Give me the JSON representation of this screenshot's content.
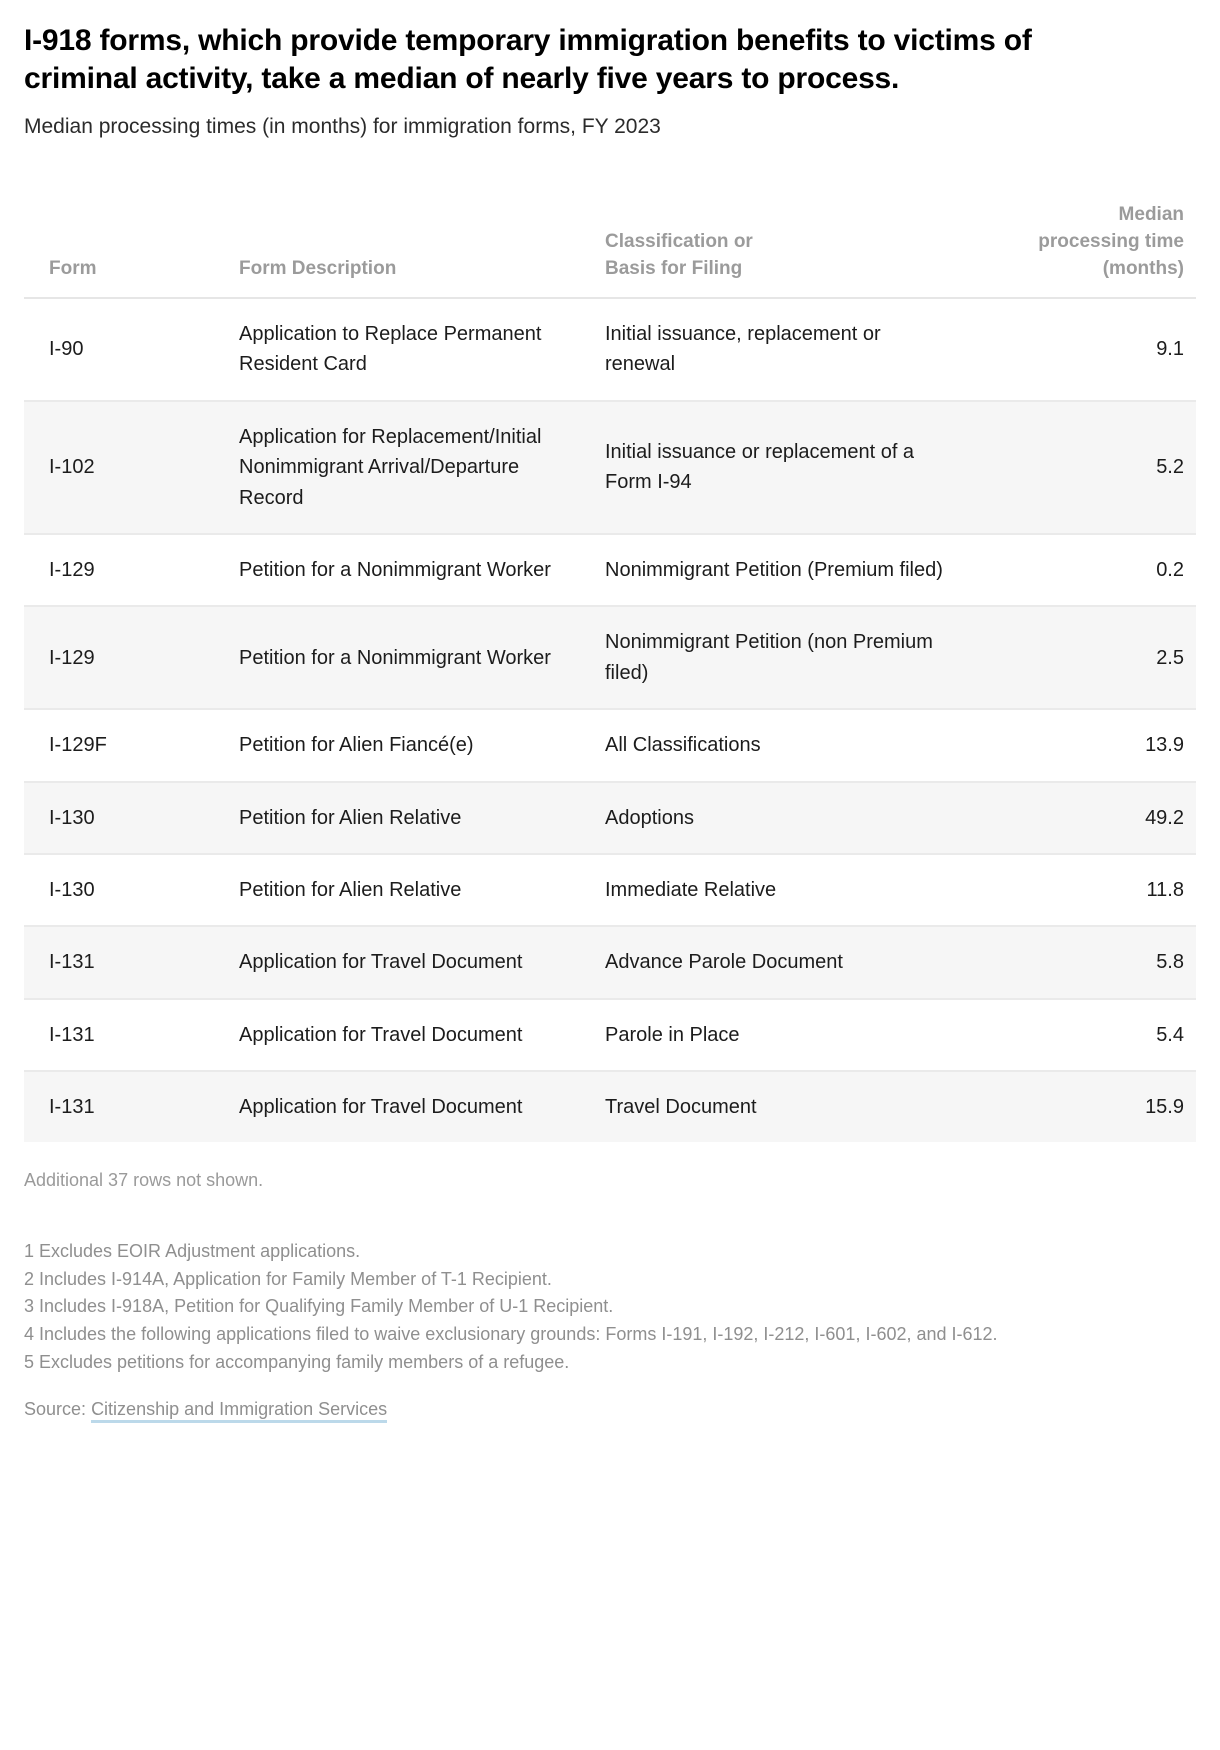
{
  "title": "I-918 forms, which provide temporary immigration benefits to victims of criminal activity, take a median of nearly five years to process.",
  "subtitle": "Median processing times (in months) for immigration forms, FY 2023",
  "table": {
    "columns": [
      {
        "key": "form",
        "label": "Form"
      },
      {
        "key": "description",
        "label": "Form Description"
      },
      {
        "key": "classification",
        "label": "Classification or Basis for Filing"
      },
      {
        "key": "median",
        "label": "Median processing time (months)"
      }
    ],
    "column_labels": {
      "form": "Form",
      "description": "Form Description",
      "classification_line1": "Classification or",
      "classification_line2": "Basis for Filing",
      "median_line1": "Median",
      "median_line2": "processing time",
      "median_line3": "(months)"
    },
    "rows": [
      {
        "form": "I-90",
        "description": "Application to Replace Permanent Resident Card",
        "classification": "Initial issuance, replacement or renewal",
        "median": "9.1"
      },
      {
        "form": "I-102",
        "description": "Application for Replacement/Initial Nonimmigrant Arrival/Departure Record",
        "classification": "Initial issuance or replacement of a Form I-94",
        "median": "5.2"
      },
      {
        "form": "I-129",
        "description": "Petition for a Nonimmigrant Worker",
        "classification": "Nonimmigrant Petition (Premium filed)",
        "median": "0.2"
      },
      {
        "form": "I-129",
        "description": "Petition for a Nonimmigrant Worker",
        "classification": "Nonimmigrant Petition (non Premium filed)",
        "median": "2.5"
      },
      {
        "form": "I-129F",
        "description": "Petition for Alien Fiancé(e)",
        "classification": "All Classifications",
        "median": "13.9"
      },
      {
        "form": "I-130",
        "description": "Petition for Alien Relative",
        "classification": "Adoptions",
        "median": "49.2"
      },
      {
        "form": "I-130",
        "description": "Petition for Alien Relative",
        "classification": "Immediate Relative",
        "median": "11.8"
      },
      {
        "form": "I-131",
        "description": "Application for Travel Document",
        "classification": "Advance Parole Document",
        "median": "5.8"
      },
      {
        "form": "I-131",
        "description": "Application for Travel Document",
        "classification": "Parole in Place",
        "median": "5.4"
      },
      {
        "form": "I-131",
        "description": "Application for Travel Document",
        "classification": "Travel Document",
        "median": "15.9"
      }
    ],
    "rows_note": "Additional 37 rows not shown."
  },
  "footnotes": [
    "1 Excludes EOIR Adjustment applications.",
    "2 Includes I-914A, Application for Family Member of T-1 Recipient.",
    "3 Includes I-918A, Petition for Qualifying Family Member of U-1 Recipient.",
    "4 Includes the following applications filed to waive exclusionary grounds: Forms I-191, I-192, I-212, I-601, I-602, and I-612.",
    "5 Excludes petitions for accompanying family members of a refugee."
  ],
  "source": {
    "prefix": "Source:",
    "link_text": "Citizenship and Immigration Services"
  },
  "chart_data": {
    "type": "table",
    "title": "I-918 forms, which provide temporary immigration benefits to victims of criminal activity, take a median of nearly five years to process.",
    "subtitle": "Median processing times (in months) for immigration forms, FY 2023",
    "xlabel": "",
    "ylabel": "Median processing time (months)",
    "categories": [
      "I-90 — Initial issuance, replacement or renewal",
      "I-102 — Initial issuance or replacement of a Form I-94",
      "I-129 — Nonimmigrant Petition (Premium filed)",
      "I-129 — Nonimmigrant Petition (non Premium filed)",
      "I-129F — All Classifications",
      "I-130 — Adoptions",
      "I-130 — Immediate Relative",
      "I-131 — Advance Parole Document",
      "I-131 — Parole in Place",
      "I-131 — Travel Document"
    ],
    "values": [
      9.1,
      5.2,
      0.2,
      2.5,
      13.9,
      49.2,
      11.8,
      5.8,
      5.4,
      15.9
    ],
    "units": "months",
    "rows_shown": 10,
    "rows_hidden": 37
  }
}
